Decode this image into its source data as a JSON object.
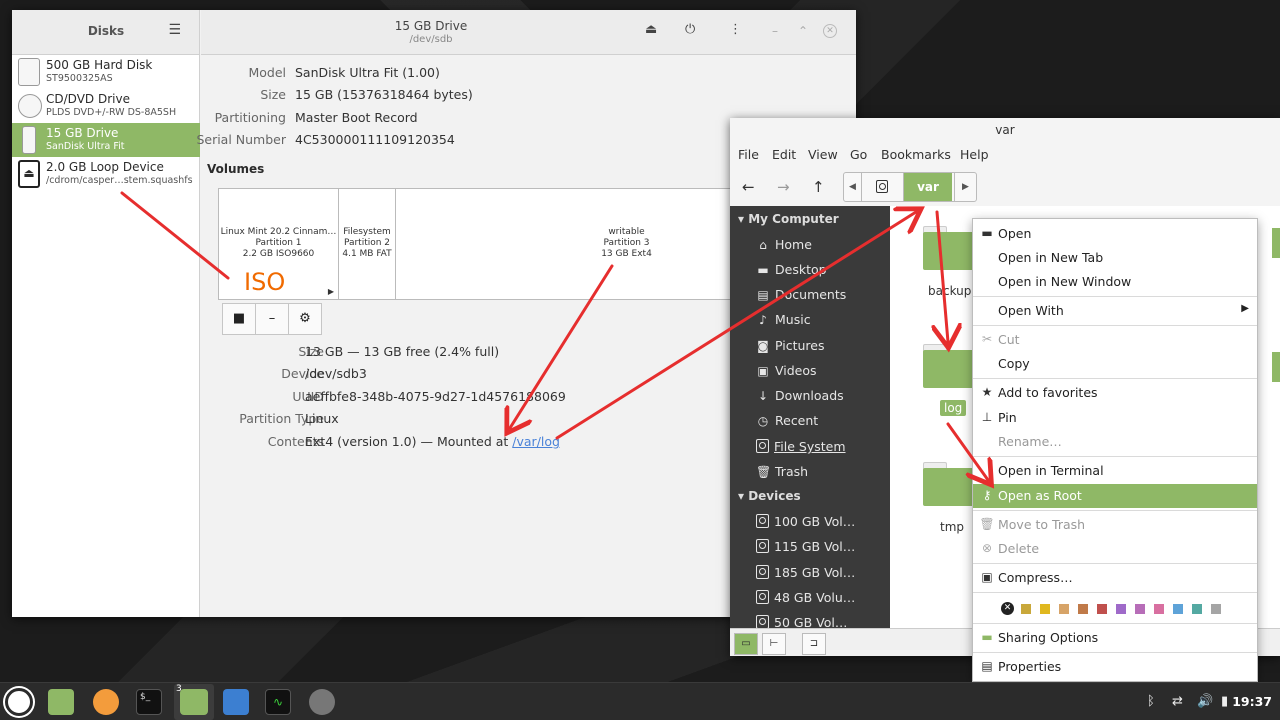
{
  "disks": {
    "sidebar_title": "Disks",
    "title": "15 GB Drive",
    "subtitle": "/dev/sdb",
    "drives": [
      {
        "name": "500 GB Hard Disk",
        "sub": "ST9500325AS"
      },
      {
        "name": "CD/DVD Drive",
        "sub": "PLDS DVD+/-RW DS-8A5SH"
      },
      {
        "name": "15 GB Drive",
        "sub": "SanDisk Ultra Fit"
      },
      {
        "name": "2.0 GB Loop Device",
        "sub": "/cdrom/casper…stem.squashfs"
      }
    ],
    "info": [
      {
        "key": "Model",
        "value": "SanDisk Ultra Fit (1.00)"
      },
      {
        "key": "Size",
        "value": "15 GB (15376318464 bytes)"
      },
      {
        "key": "Partitioning",
        "value": "Master Boot Record"
      },
      {
        "key": "Serial Number",
        "value": "4C530000111109120354"
      }
    ],
    "volumes_label": "Volumes",
    "partitions": [
      {
        "l1": "Linux Mint 20.2 Cinnam…",
        "l2": "Partition 1",
        "l3": "2.2 GB ISO9660"
      },
      {
        "l1": "Filesystem",
        "l2": "Partition 2",
        "l3": "4.1 MB FAT"
      },
      {
        "l1": "writable",
        "l2": "Partition 3",
        "l3": "13 GB Ext4"
      }
    ],
    "iso_annotation": "ISO",
    "vol_info": [
      {
        "key": "Size",
        "value": "13 GB — 13 GB free (2.4% full)"
      },
      {
        "key": "Device",
        "value": "/dev/sdb3"
      },
      {
        "key": "UUID",
        "value": "aeffbfe8-348b-4075-9d27-1d4576188069"
      },
      {
        "key": "Partition Type",
        "value": "Linux"
      },
      {
        "key": "Contents",
        "value": "Ext4 (version 1.0) — Mounted at "
      }
    ],
    "mount_link": "/var/log"
  },
  "nemo": {
    "title": "var",
    "menu": [
      "File",
      "Edit",
      "View",
      "Go",
      "Bookmarks",
      "Help"
    ],
    "breadcrumb": "var",
    "sections": {
      "my_computer": "My Computer",
      "devices": "Devices"
    },
    "places": [
      "Home",
      "Desktop",
      "Documents",
      "Music",
      "Pictures",
      "Videos",
      "Downloads",
      "Recent",
      "File System",
      "Trash"
    ],
    "devices": [
      "100 GB Vol…",
      "115 GB Vol…",
      "185 GB Vol…",
      "48 GB Volu…",
      "50 GB Vol…"
    ],
    "folders": [
      "backups",
      "log",
      "tmp"
    ]
  },
  "context_menu": {
    "items": [
      "Open",
      "Open in New Tab",
      "Open in New Window",
      "Open With",
      "Cut",
      "Copy",
      "Add to favorites",
      "Pin",
      "Rename…",
      "Open in Terminal",
      "Open as Root",
      "Move to Trash",
      "Delete",
      "Compress…",
      "Sharing Options",
      "Properties"
    ],
    "swatches": [
      "#c9a83b",
      "#e0b81f",
      "#d7a468",
      "#c07a49",
      "#c0504d",
      "#9f6ac9",
      "#b76db8",
      "#d86fa0",
      "#5ea3d8",
      "#54a9a2",
      "#a5a5a5"
    ]
  },
  "taskbar": {
    "clock": "19:37",
    "badge": "3"
  },
  "colors": {
    "accent": "#8fb866",
    "arrow": "#e62e2e",
    "annotation": "#f06a00"
  }
}
